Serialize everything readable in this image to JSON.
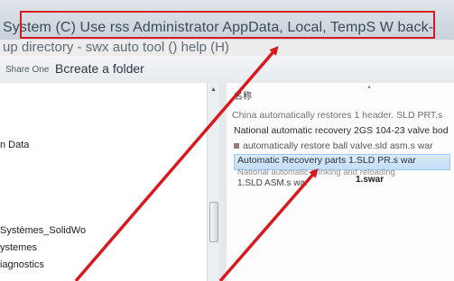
{
  "address_bar": {
    "path": "System (C) Use rss Administrator AppData, Local, TempS W back-"
  },
  "menu": {
    "text": "up directory - swx auto tool () help (H)"
  },
  "toolbar": {
    "share": "Share One",
    "create_folder": "Bcreate a folder"
  },
  "nav_pane": {
    "items": [
      {
        "label": "n Data"
      },
      {
        "label": "Systèmes_SolidWo"
      },
      {
        "label": "ystemes"
      },
      {
        "label": "iagnostics"
      }
    ]
  },
  "file_list": {
    "column_header": "名称",
    "files": [
      {
        "name": "China automatically restores 1 header. SLD PRT.s"
      },
      {
        "name": "National automatic recovery 2GS 104-23 valve bod"
      },
      {
        "name": "automatically restore ball valve.sld asm.s war"
      },
      {
        "name": "Automatic Recovery parts 1.SLD PR.s war"
      },
      {
        "name": "National automatic drinking and reloading"
      },
      {
        "name": "1.SLD ASM.s war"
      },
      {
        "name": "1.swar"
      }
    ]
  },
  "annotation": {
    "color": "#d8191d"
  }
}
